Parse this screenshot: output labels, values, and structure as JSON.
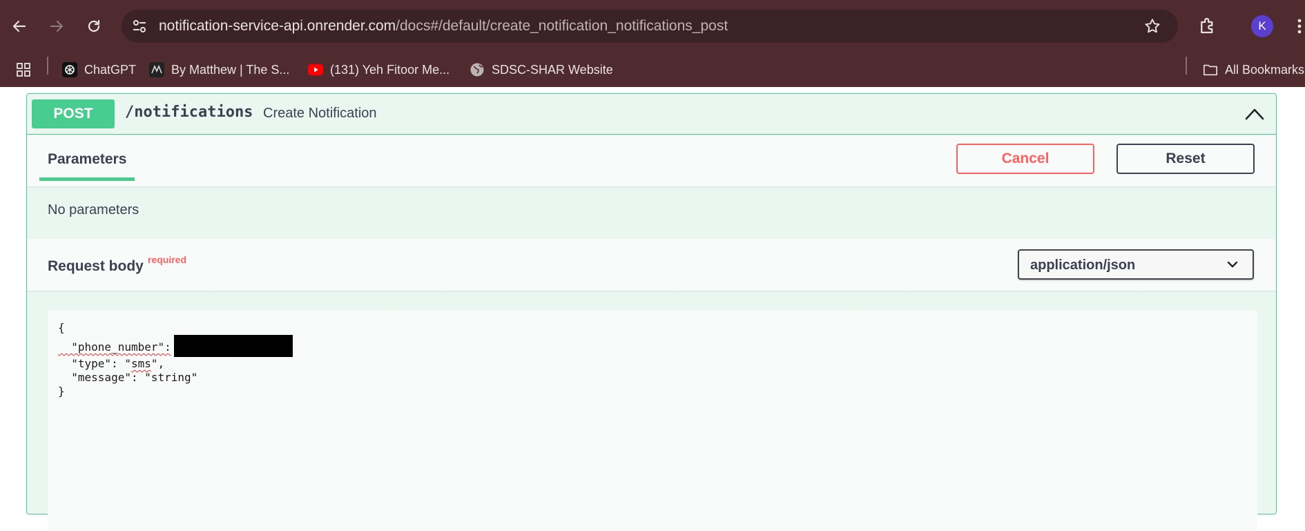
{
  "browser": {
    "url_host": "notification-service-api.onrender.com",
    "url_rest": "/docs#/default/create_notification_notifications_post",
    "profile_initial": "K",
    "bookmarks": [
      {
        "label": "ChatGPT",
        "icon": "chatgpt-icon"
      },
      {
        "label": "By Matthew | The S...",
        "icon": "site-icon"
      },
      {
        "label": "(131) Yeh Fitoor Me...",
        "icon": "youtube-icon"
      },
      {
        "label": "SDSC-SHAR Website",
        "icon": "globe-icon"
      }
    ],
    "all_bookmarks_label": "All Bookmarks"
  },
  "operation": {
    "method": "POST",
    "path": "/notifications",
    "summary": "Create Notification",
    "method_color": "#49cc90"
  },
  "parameters": {
    "tab_label": "Parameters",
    "cancel_label": "Cancel",
    "reset_label": "Reset",
    "empty_text": "No parameters"
  },
  "request_body": {
    "title": "Request body",
    "required_label": "required",
    "content_type": "application/json",
    "code": {
      "open": "{",
      "phone_key": "  \"phone_number\":",
      "type_line_prefix": "  \"type\": \"",
      "type_value": "sms",
      "type_line_suffix": "\",",
      "message_line": "  \"message\": \"string\"",
      "close": "}"
    }
  }
}
